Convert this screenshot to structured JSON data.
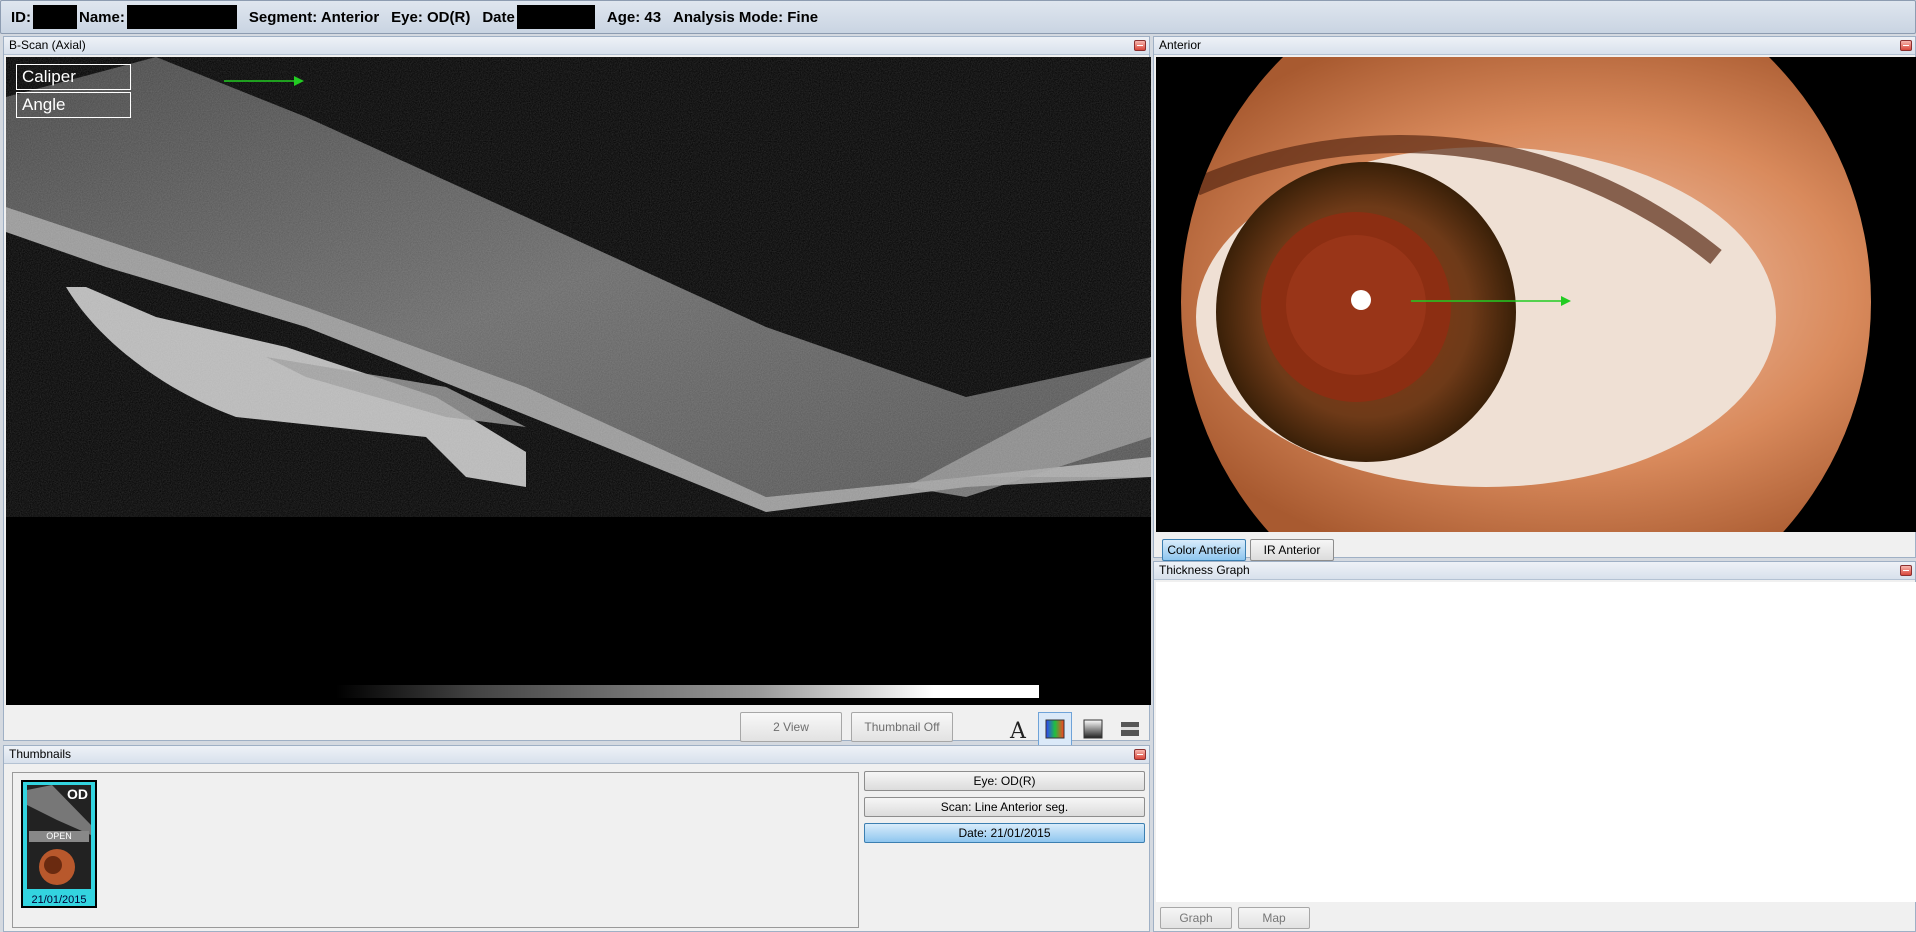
{
  "header": {
    "id_label": "ID:",
    "name_label": "Name:",
    "segment": "Segment: Anterior",
    "eye": "Eye: OD(R)",
    "date_label": "Date",
    "age": "Age: 43",
    "analysis_mode": "Analysis Mode: Fine"
  },
  "bscan": {
    "title": "B-Scan (Axial)",
    "tools": [
      "Caliper",
      "Angle"
    ],
    "buttons": {
      "two_view": "2 View",
      "thumbnail_off": "Thumbnail Off"
    },
    "icons": [
      "text-annotation-icon",
      "color-map-icon",
      "grayscale-icon",
      "inverted-grayscale-icon"
    ]
  },
  "thumbnails": {
    "title": "Thumbnails",
    "items": [
      {
        "eye": "OD",
        "label": "OPEN",
        "date": "21/01/2015"
      }
    ],
    "filters": [
      {
        "label": "Eye: OD(R)",
        "selected": false
      },
      {
        "label": "Scan: Line Anterior seg.",
        "selected": false
      },
      {
        "label": "Date: 21/01/2015",
        "selected": true
      }
    ]
  },
  "anterior": {
    "title": "Anterior",
    "tabs": [
      {
        "label": "Color Anterior",
        "selected": true
      },
      {
        "label": "IR Anterior",
        "selected": false
      }
    ]
  },
  "thickness": {
    "title": "Thickness Graph",
    "buttons": [
      "Graph",
      "Map"
    ]
  },
  "colors": {
    "marker_arrow": "#22cc22",
    "selection": "#33d4e0",
    "panel_border": "#9fb0c5"
  }
}
